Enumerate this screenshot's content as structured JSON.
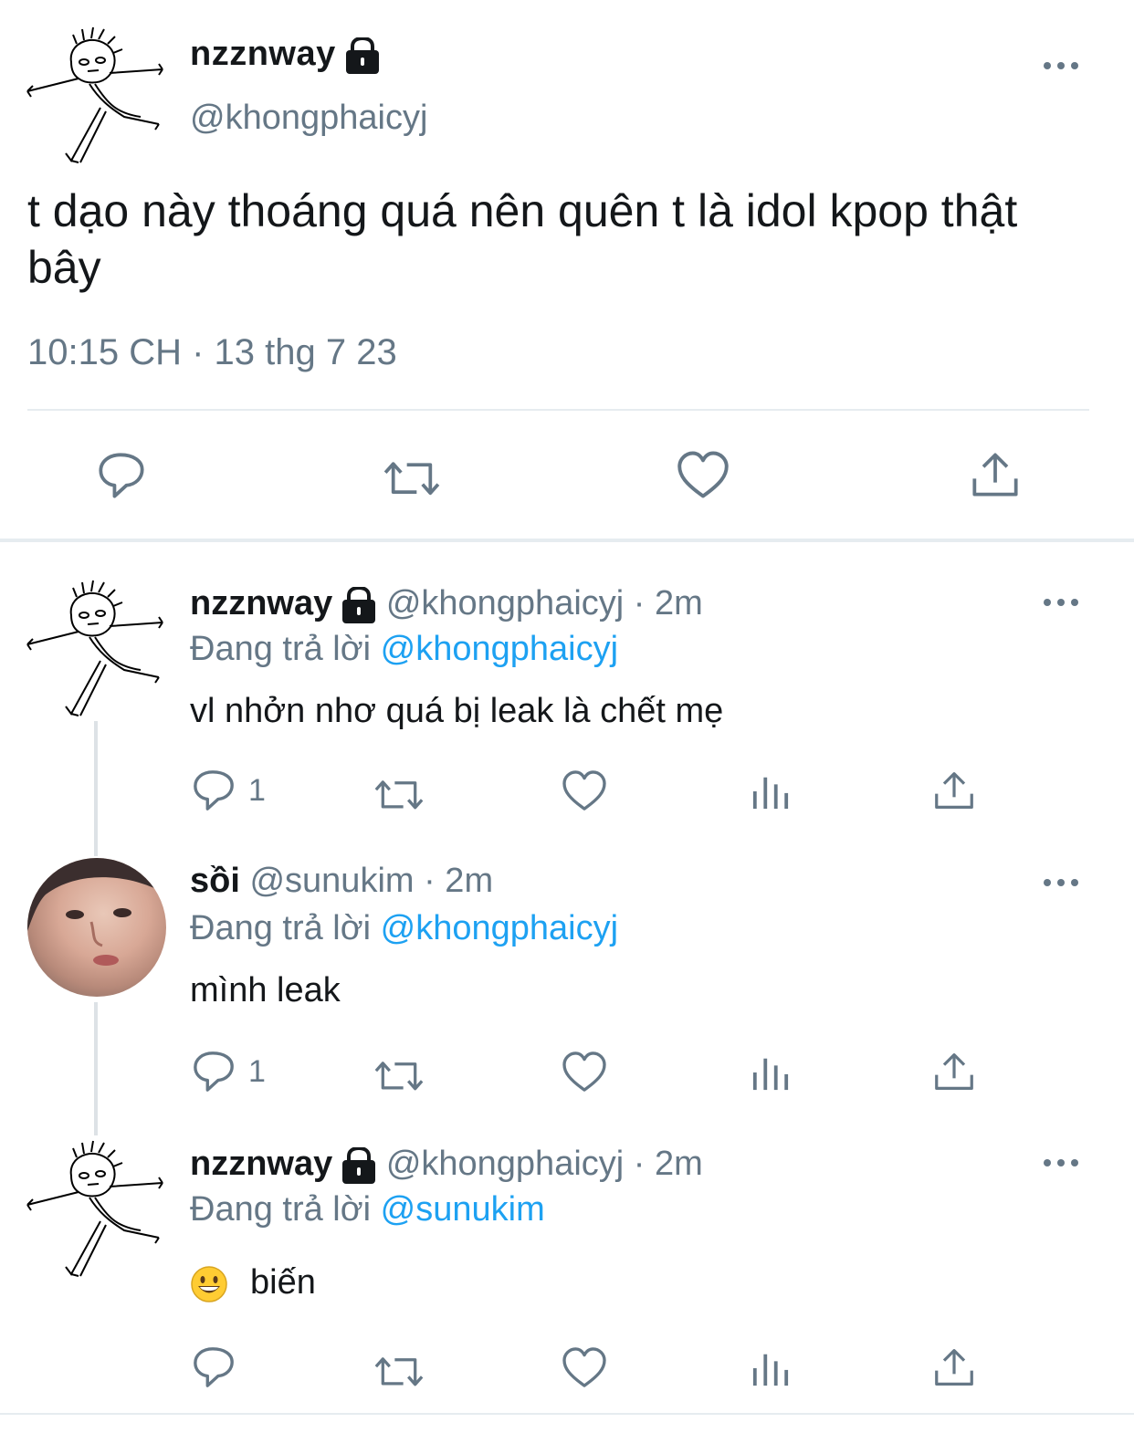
{
  "main_tweet": {
    "display_name": "nzznway",
    "handle": "@khongphaicyj",
    "text": "t dạo này thoáng quá nên quên t là idol kpop thật bây",
    "timestamp": "10:15 CH · 13 thg 7 23",
    "actions": [
      "reply-icon",
      "retweet-icon",
      "like-icon",
      "share-icon"
    ]
  },
  "replies": [
    {
      "display_name": "nzznway",
      "meta": "@khongphaicyj · 2m",
      "replying_prefix": "Đang trả lời",
      "replying_to": "@khongphaicyj",
      "text": "vl nhởn nhơ quá bị leak là chết mẹ",
      "reply_count": "1"
    },
    {
      "display_name": "sồi",
      "meta": "@sunukim · 2m",
      "replying_prefix": "Đang trả lời",
      "replying_to": "@khongphaicyj",
      "text": "mình leak",
      "reply_count": "1"
    },
    {
      "display_name": "nzznway",
      "meta": "@khongphaicyj · 2m",
      "replying_prefix": "Đang trả lời",
      "replying_to": "@sunukim",
      "text": "biến",
      "emoji": "grinning-face-emoji",
      "reply_count": ""
    }
  ],
  "colors": {
    "text": "#14171a",
    "secondary": "#657786",
    "link": "#1da1f2",
    "divider": "#e6ecf0"
  }
}
